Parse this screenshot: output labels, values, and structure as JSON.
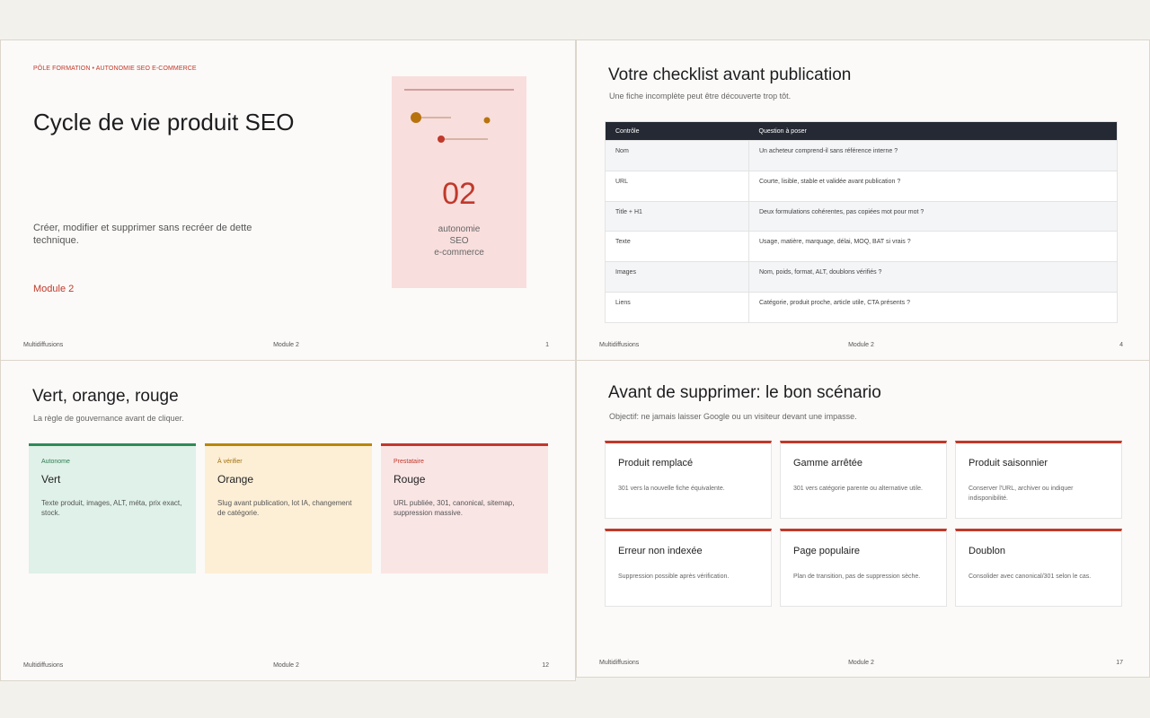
{
  "colors": {
    "accent": "#c0392b",
    "green": "#2e8b57",
    "orange": "#b8860b",
    "red": "#c0392b",
    "table_header": "#242933"
  },
  "footer": {
    "brand": "Multidiffusions",
    "module": "Module 2"
  },
  "slide1": {
    "eyebrow": "PÔLE FORMATION • AUTONOMIE SEO E-COMMERCE",
    "title": "Cycle de vie produit SEO",
    "subtitle": "Créer, modifier et supprimer sans recréer de dette technique.",
    "module_label": "Module 2",
    "card": {
      "number": "02",
      "line1": "autonomie",
      "line2": "SEO",
      "line3": "e-commerce"
    },
    "page": "1"
  },
  "slide2": {
    "title": "Votre checklist avant publication",
    "subtitle": "Une fiche incomplète peut être découverte trop tôt.",
    "headers": [
      "Contrôle",
      "Question à poser"
    ],
    "rows": [
      [
        "Nom",
        "Un acheteur comprend-il sans référence interne ?"
      ],
      [
        "URL",
        "Courte, lisible, stable et validée avant publication ?"
      ],
      [
        "Title + H1",
        "Deux formulations cohérentes, pas copiées mot pour mot ?"
      ],
      [
        "Texte",
        "Usage, matière, marquage, délai, MOQ, BAT si vrais ?"
      ],
      [
        "Images",
        "Nom, poids, format, ALT, doublons vérifiés ?"
      ],
      [
        "Liens",
        "Catégorie, produit proche, article utile, CTA présents ?"
      ]
    ],
    "page": "4"
  },
  "slide3": {
    "title": "Vert, orange, rouge",
    "subtitle": "La règle de gouvernance avant de cliquer.",
    "cards": [
      {
        "tag": "Autonome",
        "name": "Vert",
        "desc": "Texte produit, images, ALT, méta, prix exact, stock."
      },
      {
        "tag": "À vérifier",
        "name": "Orange",
        "desc": "Slug avant publication, lot IA, changement de catégorie."
      },
      {
        "tag": "Prestataire",
        "name": "Rouge",
        "desc": "URL publiée, 301, canonical, sitemap, suppression massive."
      }
    ],
    "page": "12"
  },
  "slide4": {
    "title": "Avant de supprimer: le bon scénario",
    "subtitle": "Objectif: ne jamais laisser Google ou un visiteur devant une impasse.",
    "cards": [
      {
        "name": "Produit remplacé",
        "desc": "301 vers la nouvelle fiche équivalente."
      },
      {
        "name": "Gamme arrêtée",
        "desc": "301 vers catégorie parente ou alternative utile."
      },
      {
        "name": "Produit saisonnier",
        "desc": "Conserver l'URL, archiver ou indiquer indisponibilité."
      },
      {
        "name": "Erreur non indexée",
        "desc": "Suppression possible après vérification."
      },
      {
        "name": "Page populaire",
        "desc": "Plan de transition, pas de suppression sèche."
      },
      {
        "name": "Doublon",
        "desc": "Consolider avec canonical/301 selon le cas."
      }
    ],
    "page": "17"
  }
}
